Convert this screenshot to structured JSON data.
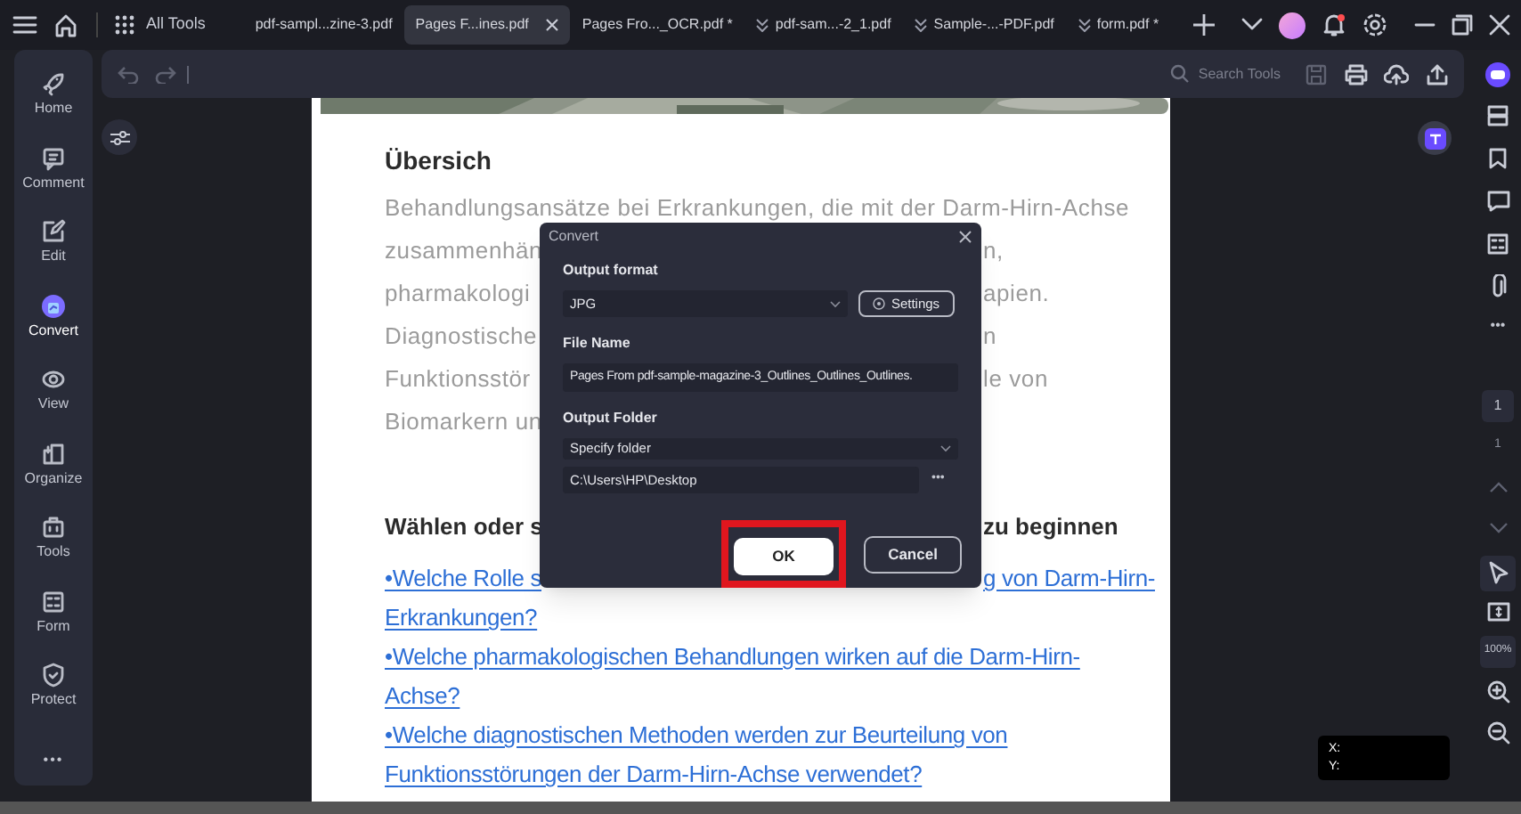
{
  "top_bar": {
    "all_tools": "All Tools",
    "tabs": [
      {
        "label": "pdf-sampl...zine-3.pdf",
        "selected": false,
        "grouped": false
      },
      {
        "label": "Pages F...ines.pdf",
        "selected": true,
        "grouped": false
      },
      {
        "label": "Pages Fro..._OCR.pdf *",
        "selected": false,
        "grouped": false
      },
      {
        "label": "pdf-sam...-2_1.pdf",
        "selected": false,
        "grouped": true
      },
      {
        "label": "Sample-...-PDF.pdf",
        "selected": false,
        "grouped": true
      },
      {
        "label": "form.pdf *",
        "selected": false,
        "grouped": true
      }
    ]
  },
  "sidebar": {
    "items": [
      {
        "label": "Home",
        "selected": false
      },
      {
        "label": "Comment",
        "selected": false
      },
      {
        "label": "Edit",
        "selected": false
      },
      {
        "label": "Convert",
        "selected": true
      },
      {
        "label": "View",
        "selected": false
      },
      {
        "label": "Organize",
        "selected": false
      },
      {
        "label": "Tools",
        "selected": false
      },
      {
        "label": "Form",
        "selected": false
      },
      {
        "label": "Protect",
        "selected": false
      }
    ],
    "more": "•••"
  },
  "toolbar": {
    "search": "Search Tools"
  },
  "document": {
    "heading": "Übersich",
    "paragraph_lines": [
      {
        "left": "Behandlungsansätze bei Erkrankungen, die mit der Darm-Hirn-Achse"
      },
      {
        "left": "zusammenhän",
        "right": "n,"
      },
      {
        "left": "pharmakologi",
        "right": "apien."
      },
      {
        "left": "Diagnostische",
        "right": "n"
      },
      {
        "left": "Funktionsstör",
        "right": "le von"
      },
      {
        "left": "Biomarkern un"
      }
    ],
    "heading_2": {
      "left": "Wählen oder s",
      "right": "zu beginnen"
    },
    "links": [
      {
        "left": "•Welche Rolle s",
        "right": "g von Darm-Hirn-"
      },
      {
        "left": "Erkrankungen?"
      },
      {
        "left": "•Welche pharmakologischen Behandlungen wirken auf die Darm-Hirn-"
      },
      {
        "left": "Achse?"
      },
      {
        "left": "•Welche diagnostischen Methoden werden zur Beurteilung von"
      },
      {
        "left": "Funktionsstörungen der Darm-Hirn-Achse verwendet?"
      }
    ]
  },
  "dialog": {
    "title": "Convert",
    "output_format_label": "Output format",
    "output_format": "JPG",
    "settings": "Settings",
    "file_name_label": "File Name",
    "file_name": "Pages From pdf-sample-magazine-3_Outlines_Outlines_Outlines.",
    "output_folder_label": "Output Folder",
    "output_folder": "Specify folder",
    "path": "C:\\Users\\HP\\Desktop",
    "browse": "•••",
    "ok": "OK",
    "cancel": "Cancel",
    "ok_highlighted": true
  },
  "right_panel": {
    "more": "•••",
    "page_input": "1",
    "page_total": "1",
    "zoom": "100%"
  },
  "coordinates": {
    "x": "X:",
    "y": "Y:"
  }
}
